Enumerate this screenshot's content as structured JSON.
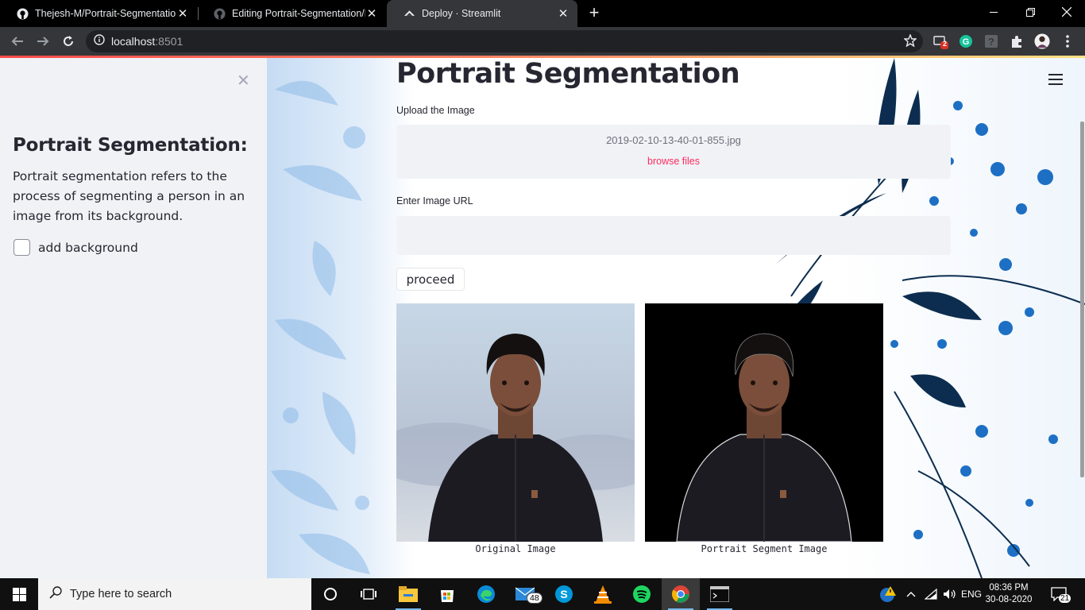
{
  "browser": {
    "tabs": [
      {
        "title": "Thejesh-M/Portrait-Segmentation",
        "favicon": "github-icon",
        "active": false
      },
      {
        "title": "Editing Portrait-Segmentation/RE",
        "favicon": "github-icon",
        "active": false
      },
      {
        "title": "Deploy · Streamlit",
        "favicon": "streamlit-icon",
        "active": true
      }
    ],
    "url_host": "localhost",
    "url_port": ":8501",
    "extension_badge": "2"
  },
  "sidebar": {
    "title": "Portrait Segmentation:",
    "description": "Portrait segmentation refers to the process of segmenting a person in an image from its background.",
    "checkbox_label": "add background",
    "checkbox_checked": false
  },
  "main": {
    "title": "Portrait Segmentation",
    "upload_label": "Upload the Image",
    "uploaded_file": "2019-02-10-13-40-01-855.jpg",
    "browse_label": "browse files",
    "url_label": "Enter Image URL",
    "url_value": "",
    "proceed_label": "proceed",
    "caption_original": "Original Image",
    "caption_segment": "Portrait Segment Image"
  },
  "taskbar": {
    "search_placeholder": "Type here to search",
    "mail_badge": "48",
    "language": "ENG",
    "time": "08:36 PM",
    "date": "30-08-2020",
    "notification_count": "21"
  },
  "colors": {
    "accent": "#ff2b5f",
    "sidebar_bg": "#f0f2f6",
    "text": "#262730"
  }
}
